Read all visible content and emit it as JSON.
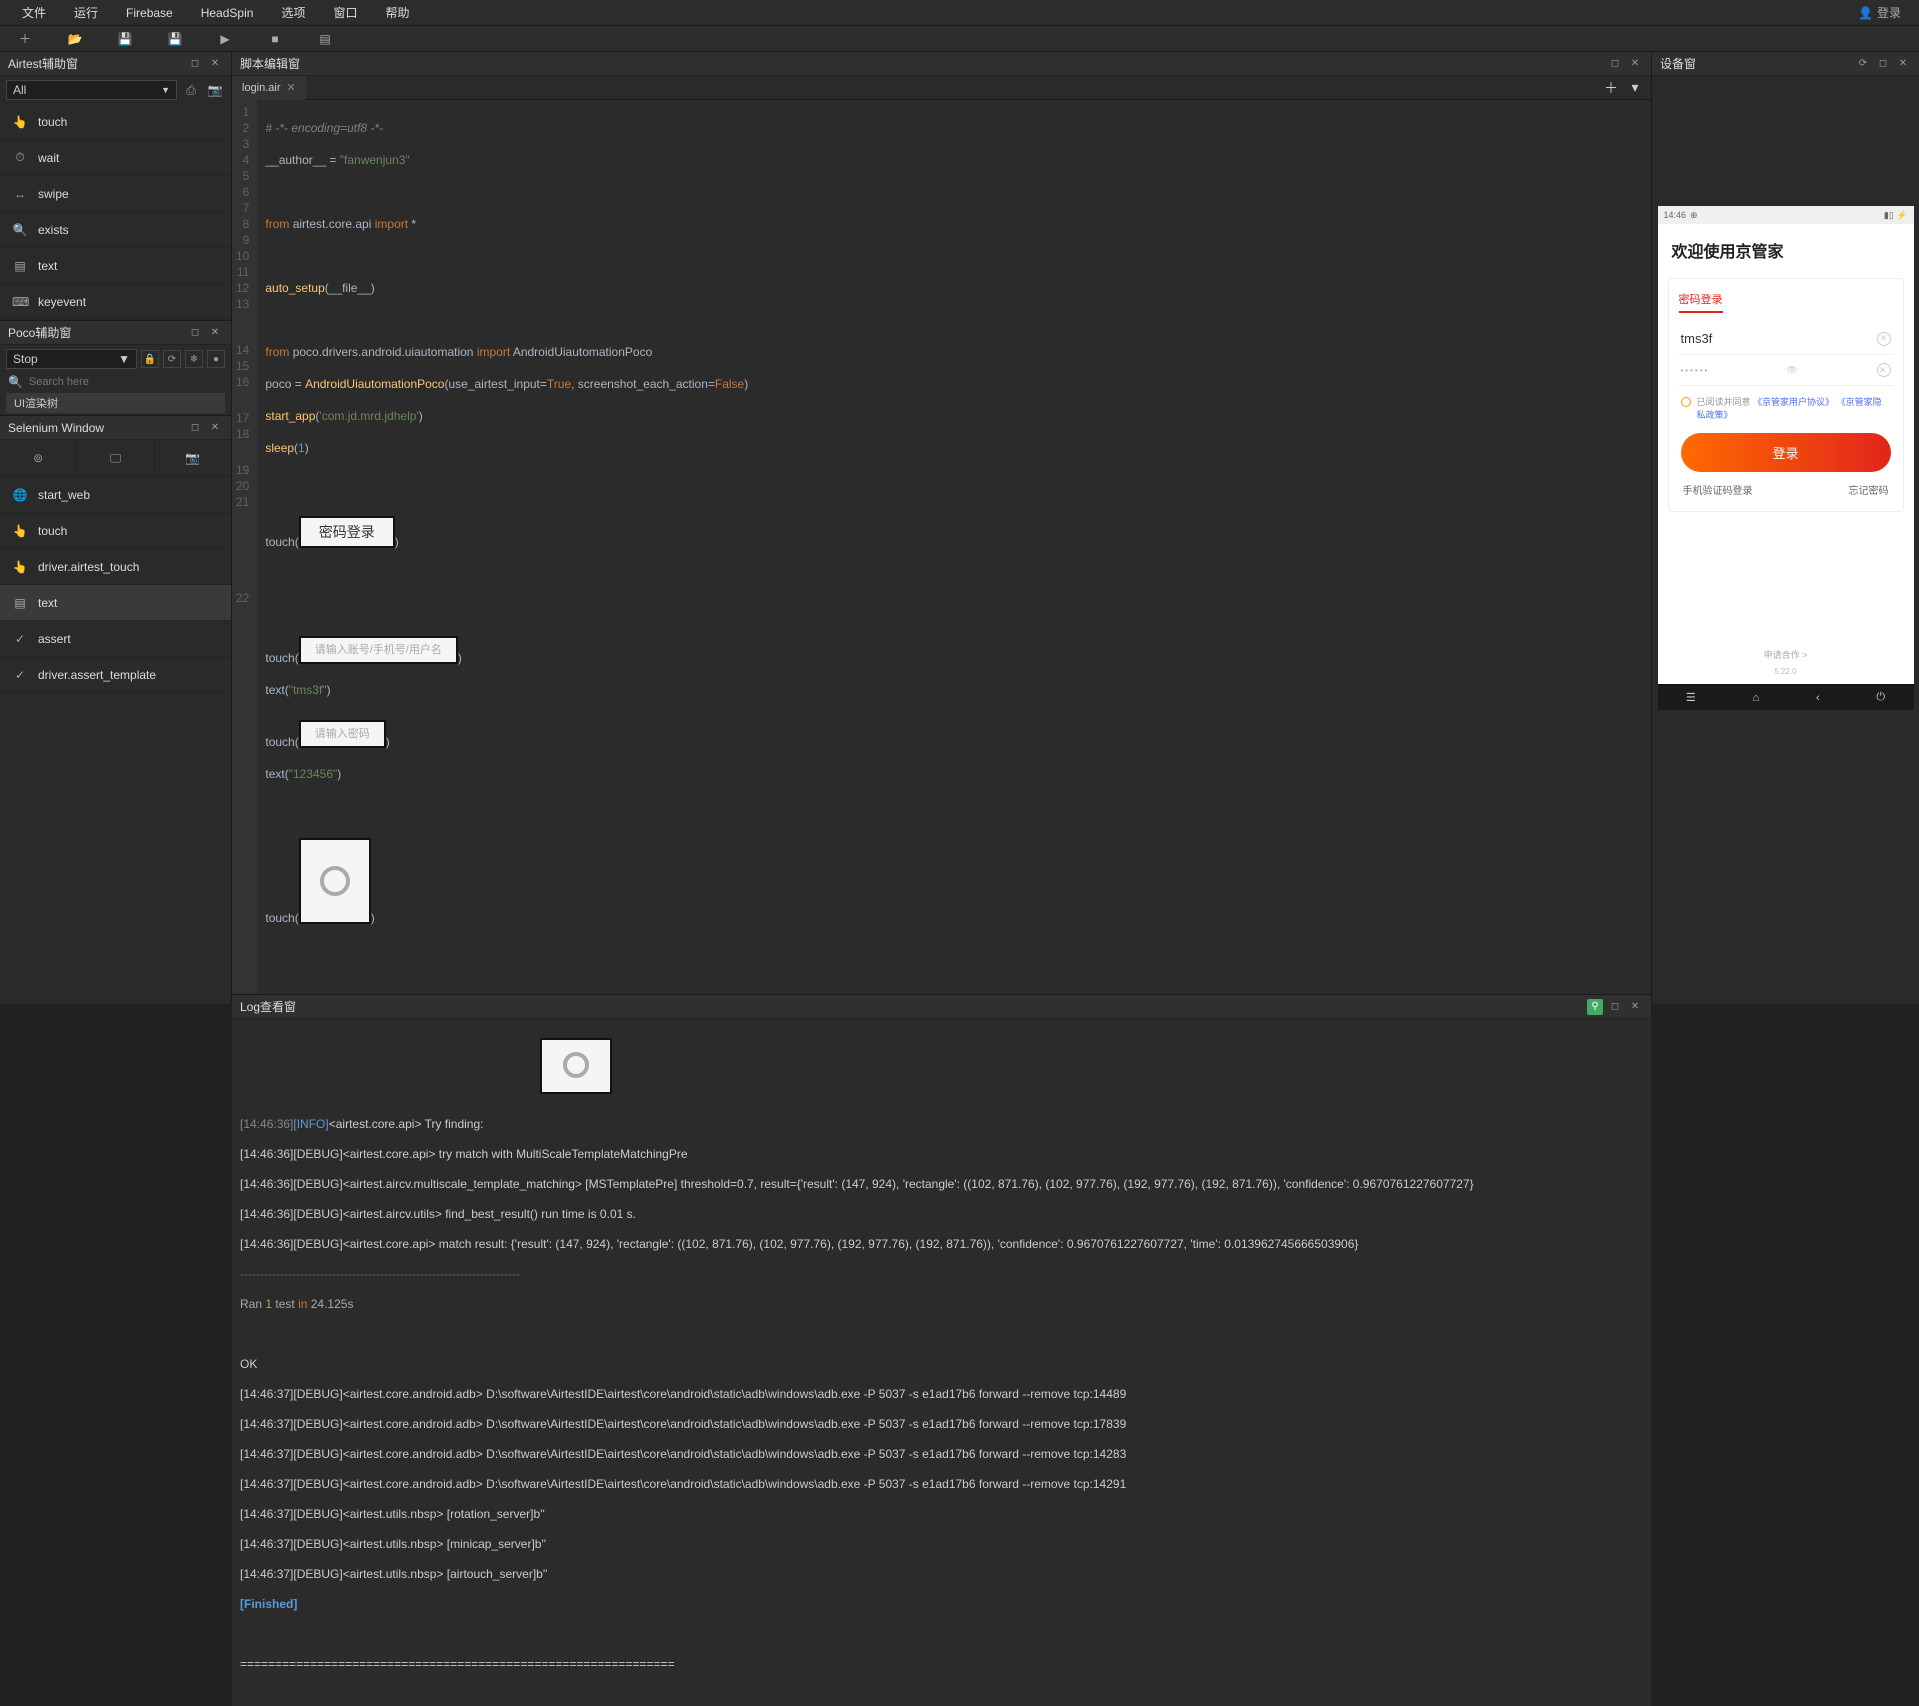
{
  "menu": {
    "items": [
      "文件",
      "运行",
      "Firebase",
      "HeadSpin",
      "选项",
      "窗口",
      "帮助"
    ],
    "login": "登录"
  },
  "airtest": {
    "title": "Airtest辅助窗",
    "combo": "All",
    "commands": [
      {
        "icon": "👆",
        "label": "touch"
      },
      {
        "icon": "⏱",
        "label": "wait"
      },
      {
        "icon": "↔",
        "label": "swipe"
      },
      {
        "icon": "🔍",
        "label": "exists"
      },
      {
        "icon": "▤",
        "label": "text"
      },
      {
        "icon": "⌨",
        "label": "keyevent"
      }
    ]
  },
  "poco": {
    "title": "Poco辅助窗",
    "combo": "Stop",
    "search_ph": "Search here",
    "tree": "UI渲染树"
  },
  "selenium": {
    "title": "Selenium Window",
    "commands": [
      {
        "icon": "🌐",
        "label": "start_web"
      },
      {
        "icon": "👆",
        "label": "touch"
      },
      {
        "icon": "👆",
        "label": "driver.airtest_touch"
      },
      {
        "icon": "▤",
        "label": "text",
        "sel": true
      },
      {
        "icon": "✓",
        "label": "assert"
      },
      {
        "icon": "✓",
        "label": "driver.assert_template"
      }
    ]
  },
  "editor": {
    "title": "脚本编辑窗",
    "tab": "login.air",
    "btn_label": "密码登录",
    "lines": {
      "l1": "# -*- encoding=utf8 -*-",
      "l2a": "__author__ = ",
      "l2b": "\"fanwenjun3\"",
      "l4a": "from",
      "l4b": " airtest.core.api ",
      "l4c": "import",
      "l4d": " *",
      "l6a": "auto_setup",
      "l6b": "(__file__)",
      "l8a": "from",
      "l8b": " poco.drivers.android.uiautomation ",
      "l8c": "import",
      "l8d": " AndroidUiautomationPoco",
      "l9a": "poco = ",
      "l9b": "AndroidUiautomationPoco",
      "l9c": "(use_airtest_input=",
      "l9d": "True",
      "l9e": ", screenshot_each_action=",
      "l9f": "False",
      "l9g": ")",
      "l10a": "start_app",
      "l10b": "(",
      "l10c": "'com.jd.mrd.jdhelp'",
      "l10d": ")",
      "l11a": "sleep",
      "l11b": "(",
      "l11c": "1",
      "l11d": ")",
      "touch": "touch(",
      "text17a": "text(",
      "text17b": "\"tms3f\"",
      "text17c": ")",
      "text20a": "text(",
      "text20b": "\"123456\"",
      "text20c": ")",
      "ph_user": "请输入账号/手机号/用户名",
      "ph_pwd": "请输入密码"
    }
  },
  "log": {
    "title": "Log查看窗",
    "pre": "[14:46:36][INFO]<airtest.core.api> Try finding: ",
    "l2": "[14:46:36][DEBUG]<airtest.core.api> try match with MultiScaleTemplateMatchingPre",
    "l3": "[14:46:36][DEBUG]<airtest.aircv.multiscale_template_matching> [MSTemplatePre] threshold=0.7, result={'result': (147, 924), 'rectangle': ((102, 871.76), (102, 977.76), (192, 977.76), (192, 871.76)), 'confidence': 0.9670761227607727}",
    "l4": "[14:46:36][DEBUG]<airtest.aircv.utils> find_best_result() run time is 0.01 s.",
    "l5": "[14:46:36][DEBUG]<airtest.core.api> match result: {'result': (147, 924), 'rectangle': ((102, 871.76), (102, 977.76), (192, 977.76), (192, 871.76)), 'confidence': 0.9670761227607727, 'time': 0.013962745666503906}",
    "ran": "Ran 1 test in 24.125s",
    "ok": "OK",
    "adb1": "[14:46:37][DEBUG]<airtest.core.android.adb> D:\\software\\AirtestIDE\\airtest\\core\\android\\static\\adb\\windows\\adb.exe -P 5037 -s e1ad17b6 forward --remove tcp:14489",
    "adb2": "[14:46:37][DEBUG]<airtest.core.android.adb> D:\\software\\AirtestIDE\\airtest\\core\\android\\static\\adb\\windows\\adb.exe -P 5037 -s e1ad17b6 forward --remove tcp:17839",
    "adb3": "[14:46:37][DEBUG]<airtest.core.android.adb> D:\\software\\AirtestIDE\\airtest\\core\\android\\static\\adb\\windows\\adb.exe -P 5037 -s e1ad17b6 forward --remove tcp:14283",
    "adb4": "[14:46:37][DEBUG]<airtest.core.android.adb> D:\\software\\AirtestIDE\\airtest\\core\\android\\static\\adb\\windows\\adb.exe -P 5037 -s e1ad17b6 forward --remove tcp:14291",
    "rot": "[14:46:37][DEBUG]<airtest.utils.nbsp> [rotation_server]b''",
    "min": "[14:46:37][DEBUG]<airtest.utils.nbsp> [minicap_server]b''",
    "air": "[14:46:37][DEBUG]<airtest.utils.nbsp> [airtouch_server]b''",
    "fin": "[Finished]",
    "sep": "=============================================================="
  },
  "device": {
    "title": "设备窗",
    "phone": {
      "time": "14:46",
      "welcome": "欢迎使用京管家",
      "tab": "密码登录",
      "user": "tms3f",
      "pwd": "••••••",
      "terms_pre": "已阅读并同意",
      "terms_l1": "《京管家用户协议》",
      "terms_l2": "《京管家隐私政策》",
      "login": "登录",
      "sms": "手机验证码登录",
      "forgot": "忘记密码",
      "coop": "申请合作 >",
      "ver": "5.22.0"
    }
  }
}
